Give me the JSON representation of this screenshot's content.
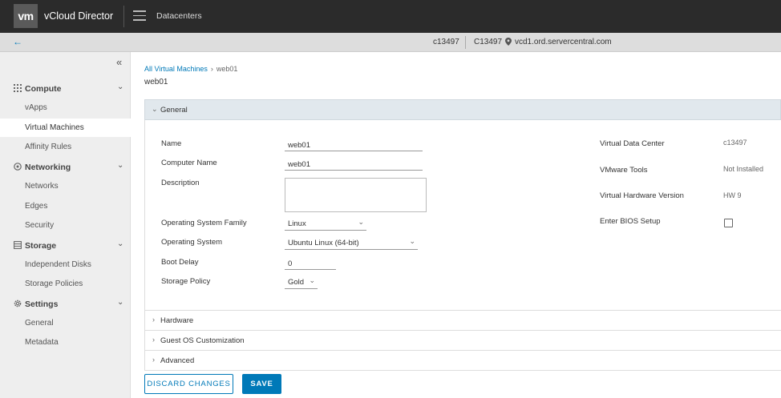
{
  "header": {
    "logo_text": "vm",
    "app_title": "vCloud Director",
    "nav_label": "Datacenters"
  },
  "context": {
    "org": "c13497",
    "user": "C13497",
    "host": "vcd1.ord.servercentral.com"
  },
  "sidebar": {
    "sections": [
      {
        "label": "Compute",
        "icon": "grid-icon",
        "items": [
          {
            "label": "vApps"
          },
          {
            "label": "Virtual Machines",
            "active": true
          },
          {
            "label": "Affinity Rules"
          }
        ]
      },
      {
        "label": "Networking",
        "icon": "network-icon",
        "items": [
          {
            "label": "Networks"
          },
          {
            "label": "Edges"
          },
          {
            "label": "Security"
          }
        ]
      },
      {
        "label": "Storage",
        "icon": "storage-icon",
        "items": [
          {
            "label": "Independent Disks"
          },
          {
            "label": "Storage Policies"
          }
        ]
      },
      {
        "label": "Settings",
        "icon": "gear-icon",
        "items": [
          {
            "label": "General"
          },
          {
            "label": "Metadata"
          }
        ]
      }
    ]
  },
  "breadcrumb": {
    "parent": "All Virtual Machines",
    "current": "web01"
  },
  "page_title": "web01",
  "general": {
    "header": "General",
    "fields": {
      "name_label": "Name",
      "name_value": "web01",
      "computer_name_label": "Computer Name",
      "computer_name_value": "web01",
      "description_label": "Description",
      "description_value": "",
      "os_family_label": "Operating System Family",
      "os_family_value": "Linux",
      "os_label": "Operating System",
      "os_value": "Ubuntu Linux (64-bit)",
      "boot_delay_label": "Boot Delay",
      "boot_delay_value": "0",
      "storage_policy_label": "Storage Policy",
      "storage_policy_value": "Gold"
    },
    "info": {
      "vdc_label": "Virtual Data Center",
      "vdc_value": "c13497",
      "tools_label": "VMware Tools",
      "tools_value": "Not Installed",
      "hw_label": "Virtual Hardware Version",
      "hw_value": "HW 9",
      "bios_label": "Enter BIOS Setup",
      "bios_checked": false
    }
  },
  "panels": {
    "hardware": "Hardware",
    "guest_os": "Guest OS Customization",
    "advanced": "Advanced"
  },
  "buttons": {
    "discard": "DISCARD CHANGES",
    "save": "SAVE"
  },
  "colors": {
    "accent": "#0079b8",
    "header_bg": "#2b2b2b",
    "sidebar_bg": "#eeeeee"
  }
}
